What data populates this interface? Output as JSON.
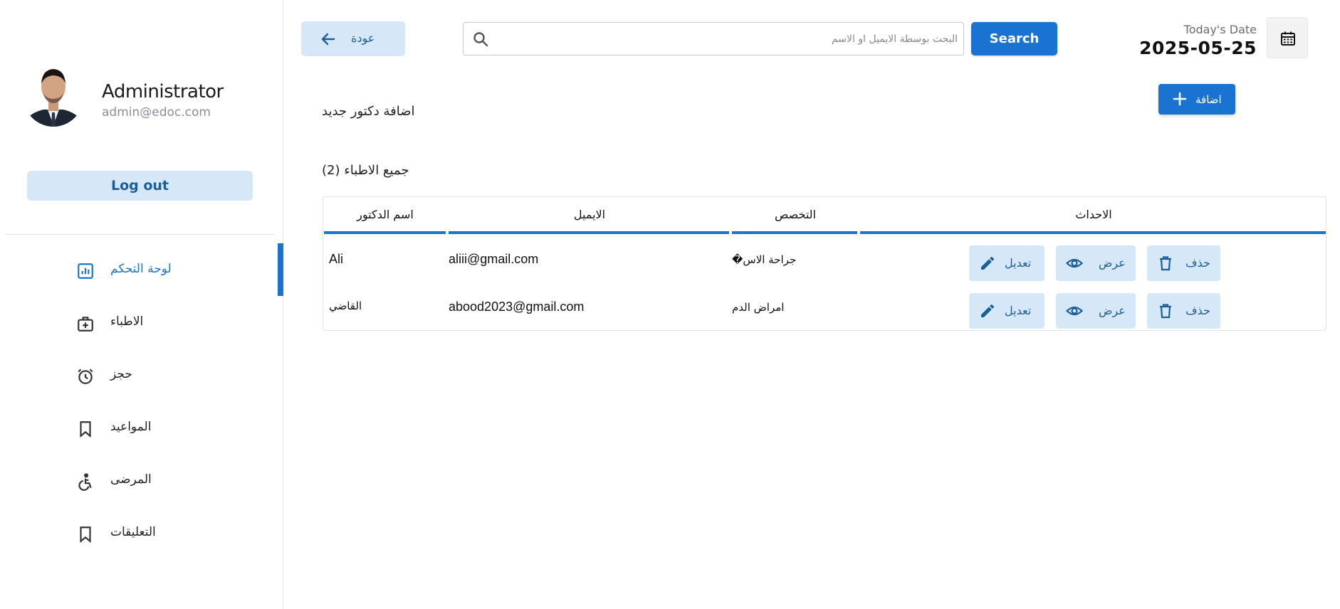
{
  "user": {
    "name": "Administrator",
    "email": "admin@edoc.com"
  },
  "sidebar": {
    "logout_label": "Log out",
    "items": [
      {
        "label": "لوحة التحكم",
        "icon": "dashboard-icon",
        "active": true
      },
      {
        "label": "الاطباء",
        "icon": "medical-bag-icon",
        "active": false
      },
      {
        "label": "حجز",
        "icon": "alarm-clock-icon",
        "active": false
      },
      {
        "label": "المواعيد",
        "icon": "bookmark-icon",
        "active": false
      },
      {
        "label": "المرضى",
        "icon": "accessibility-icon",
        "active": false
      },
      {
        "label": "التعليقات",
        "icon": "bookmark-icon",
        "active": false
      }
    ]
  },
  "topbar": {
    "back_label": "عودة",
    "search_placeholder": "البحث بوسطة الايميل او الاسم",
    "search_value": "",
    "search_button": "Search",
    "date_label": "Today's Date",
    "date_value": "2025-05-25"
  },
  "main": {
    "add_title": "اضافة دكتور جديد",
    "add_button": "اضافة",
    "list_title": "جميع الاطباء (2)"
  },
  "table": {
    "headers": {
      "name": "اسم الدكتور",
      "email": "الايميل",
      "specialty": "التخصص",
      "actions": "الاحداث"
    },
    "rows": [
      {
        "name": "Ali",
        "email": "aliii@gmail.com",
        "specialty": "جراحة الاس�"
      },
      {
        "name": "القاضي",
        "email": "abood2023@gmail.com",
        "specialty": "امراض الدم"
      }
    ],
    "actions": {
      "edit": "تعديل",
      "view": "عرض",
      "delete": "حذف"
    }
  },
  "colors": {
    "accent": "#1a73d0",
    "accent_light": "#d6e7f8",
    "accent_text": "#1b5e98"
  }
}
